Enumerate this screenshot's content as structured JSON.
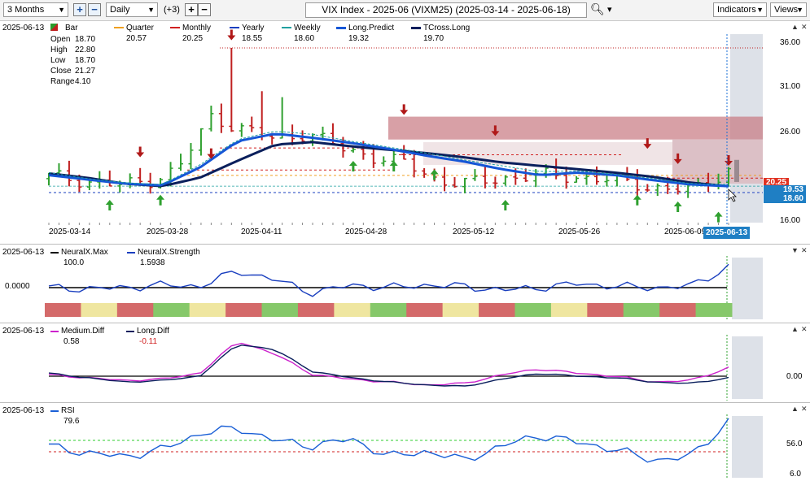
{
  "toolbar": {
    "range_value": "3 Months",
    "interval_value": "Daily",
    "interval_offset": "(+3)",
    "title": "VIX Index - 2025-06 (VIXM25) (2025-03-14 - 2025-06-18)",
    "indicators_label": "Indicators",
    "views_label": "Views"
  },
  "main_panel": {
    "date": "2025-06-13",
    "bar_label": "Bar",
    "ohlc": [
      {
        "k": "Open",
        "v": "18.70"
      },
      {
        "k": "High",
        "v": "22.80"
      },
      {
        "k": "Low",
        "v": "18.70"
      },
      {
        "k": "Close",
        "v": "21.27"
      },
      {
        "k": "Range",
        "v": "4.10"
      }
    ],
    "legend": [
      {
        "name": "Quarter",
        "value": "20.57",
        "color": "#f0a020"
      },
      {
        "name": "Monthly",
        "value": "20.25",
        "color": "#d02020"
      },
      {
        "name": "Yearly",
        "value": "18.55",
        "color": "#1a3fbf"
      },
      {
        "name": "Weekly",
        "value": "18.60",
        "color": "#20a0a0"
      },
      {
        "name": "Long.Predict",
        "value": "19.32",
        "color": "#1556d6"
      },
      {
        "name": "TCross.Long",
        "value": "19.70",
        "color": "#0a1f5c"
      }
    ],
    "y_ticks": [
      "36.00",
      "31.00",
      "26.00",
      "16.00"
    ],
    "price_tags": [
      {
        "text": "19.53",
        "color": "#1f7fc4"
      },
      {
        "text": "18.60",
        "color": "#1f7fc4"
      },
      {
        "text": "20.25",
        "color": "#e03020"
      }
    ],
    "x_ticks": [
      "2025-03-14",
      "2025-03-28",
      "2025-04-11",
      "2025-04-28",
      "2025-05-12",
      "2025-05-26",
      "2025-06-09"
    ],
    "cursor_date": "2025-06-13"
  },
  "neural_panel": {
    "date": "2025-06-13",
    "legend": [
      {
        "name": "NeuralX.Max",
        "value": "100.0",
        "color": "#000000"
      },
      {
        "name": "NeuralX.Strength",
        "value": "1.5938",
        "color": "#1a3fbf"
      }
    ],
    "y_ticks": [
      "0.0000"
    ]
  },
  "diff_panel": {
    "date": "2025-06-13",
    "legend": [
      {
        "name": "Medium.Diff",
        "value": "0.58",
        "color": "#cc22cc"
      },
      {
        "name": "Long.Diff",
        "value": "-0.11",
        "color": "#0a1f5c"
      }
    ],
    "y_ticks": [
      "0.00"
    ]
  },
  "rsi_panel": {
    "date": "2025-06-13",
    "legend": [
      {
        "name": "RSI",
        "value": "79.6",
        "color": "#1a5fd6"
      }
    ],
    "y_ticks": [
      "56.0",
      "6.0"
    ]
  },
  "chart_data": [
    {
      "type": "line",
      "title": "VIX Index - 2025-06 (VIXM25)",
      "x": [
        "2025-03-14",
        "2025-03-28",
        "2025-04-11",
        "2025-04-28",
        "2025-05-12",
        "2025-05-26",
        "2025-06-09",
        "2025-06-13"
      ],
      "series": [
        {
          "name": "Long.Predict",
          "values": [
            20.5,
            19.6,
            24.8,
            23.7,
            22.0,
            20.8,
            19.5,
            19.32
          ]
        },
        {
          "name": "TCross.Long",
          "values": [
            20.8,
            19.3,
            22.4,
            24.0,
            22.9,
            21.7,
            20.3,
            19.7
          ]
        }
      ],
      "close": [
        20.0,
        21.3,
        27.2,
        23.8,
        19.6,
        20.4,
        18.9,
        21.27
      ],
      "levels": {
        "Quarter": 20.57,
        "Monthly": 20.25,
        "Yearly": 18.55,
        "Weekly": 18.6
      },
      "ylim": [
        15,
        38
      ]
    },
    {
      "type": "line",
      "title": "",
      "series": [
        {
          "name": "NeuralX.Strength",
          "values": [
            0.0,
            -0.2,
            0.1,
            0.3,
            -0.1,
            0.2,
            0.4,
            1.59
          ]
        },
        {
          "name": "NeuralX.Max",
          "values": [
            0,
            0,
            0,
            0,
            0,
            0,
            0,
            0
          ]
        }
      ]
    },
    {
      "type": "line",
      "title": "",
      "series": [
        {
          "name": "Medium.Diff",
          "values": [
            0.1,
            -0.3,
            2.5,
            0.0,
            -0.6,
            0.2,
            -0.2,
            0.58
          ]
        },
        {
          "name": "Long.Diff",
          "values": [
            0.0,
            -0.4,
            2.2,
            0.1,
            -0.5,
            0.1,
            -0.3,
            -0.11
          ]
        }
      ]
    },
    {
      "type": "line",
      "title": "",
      "series": [
        {
          "name": "RSI",
          "values": [
            52,
            38,
            60,
            45,
            40,
            52,
            35,
            79.6
          ]
        }
      ]
    }
  ]
}
